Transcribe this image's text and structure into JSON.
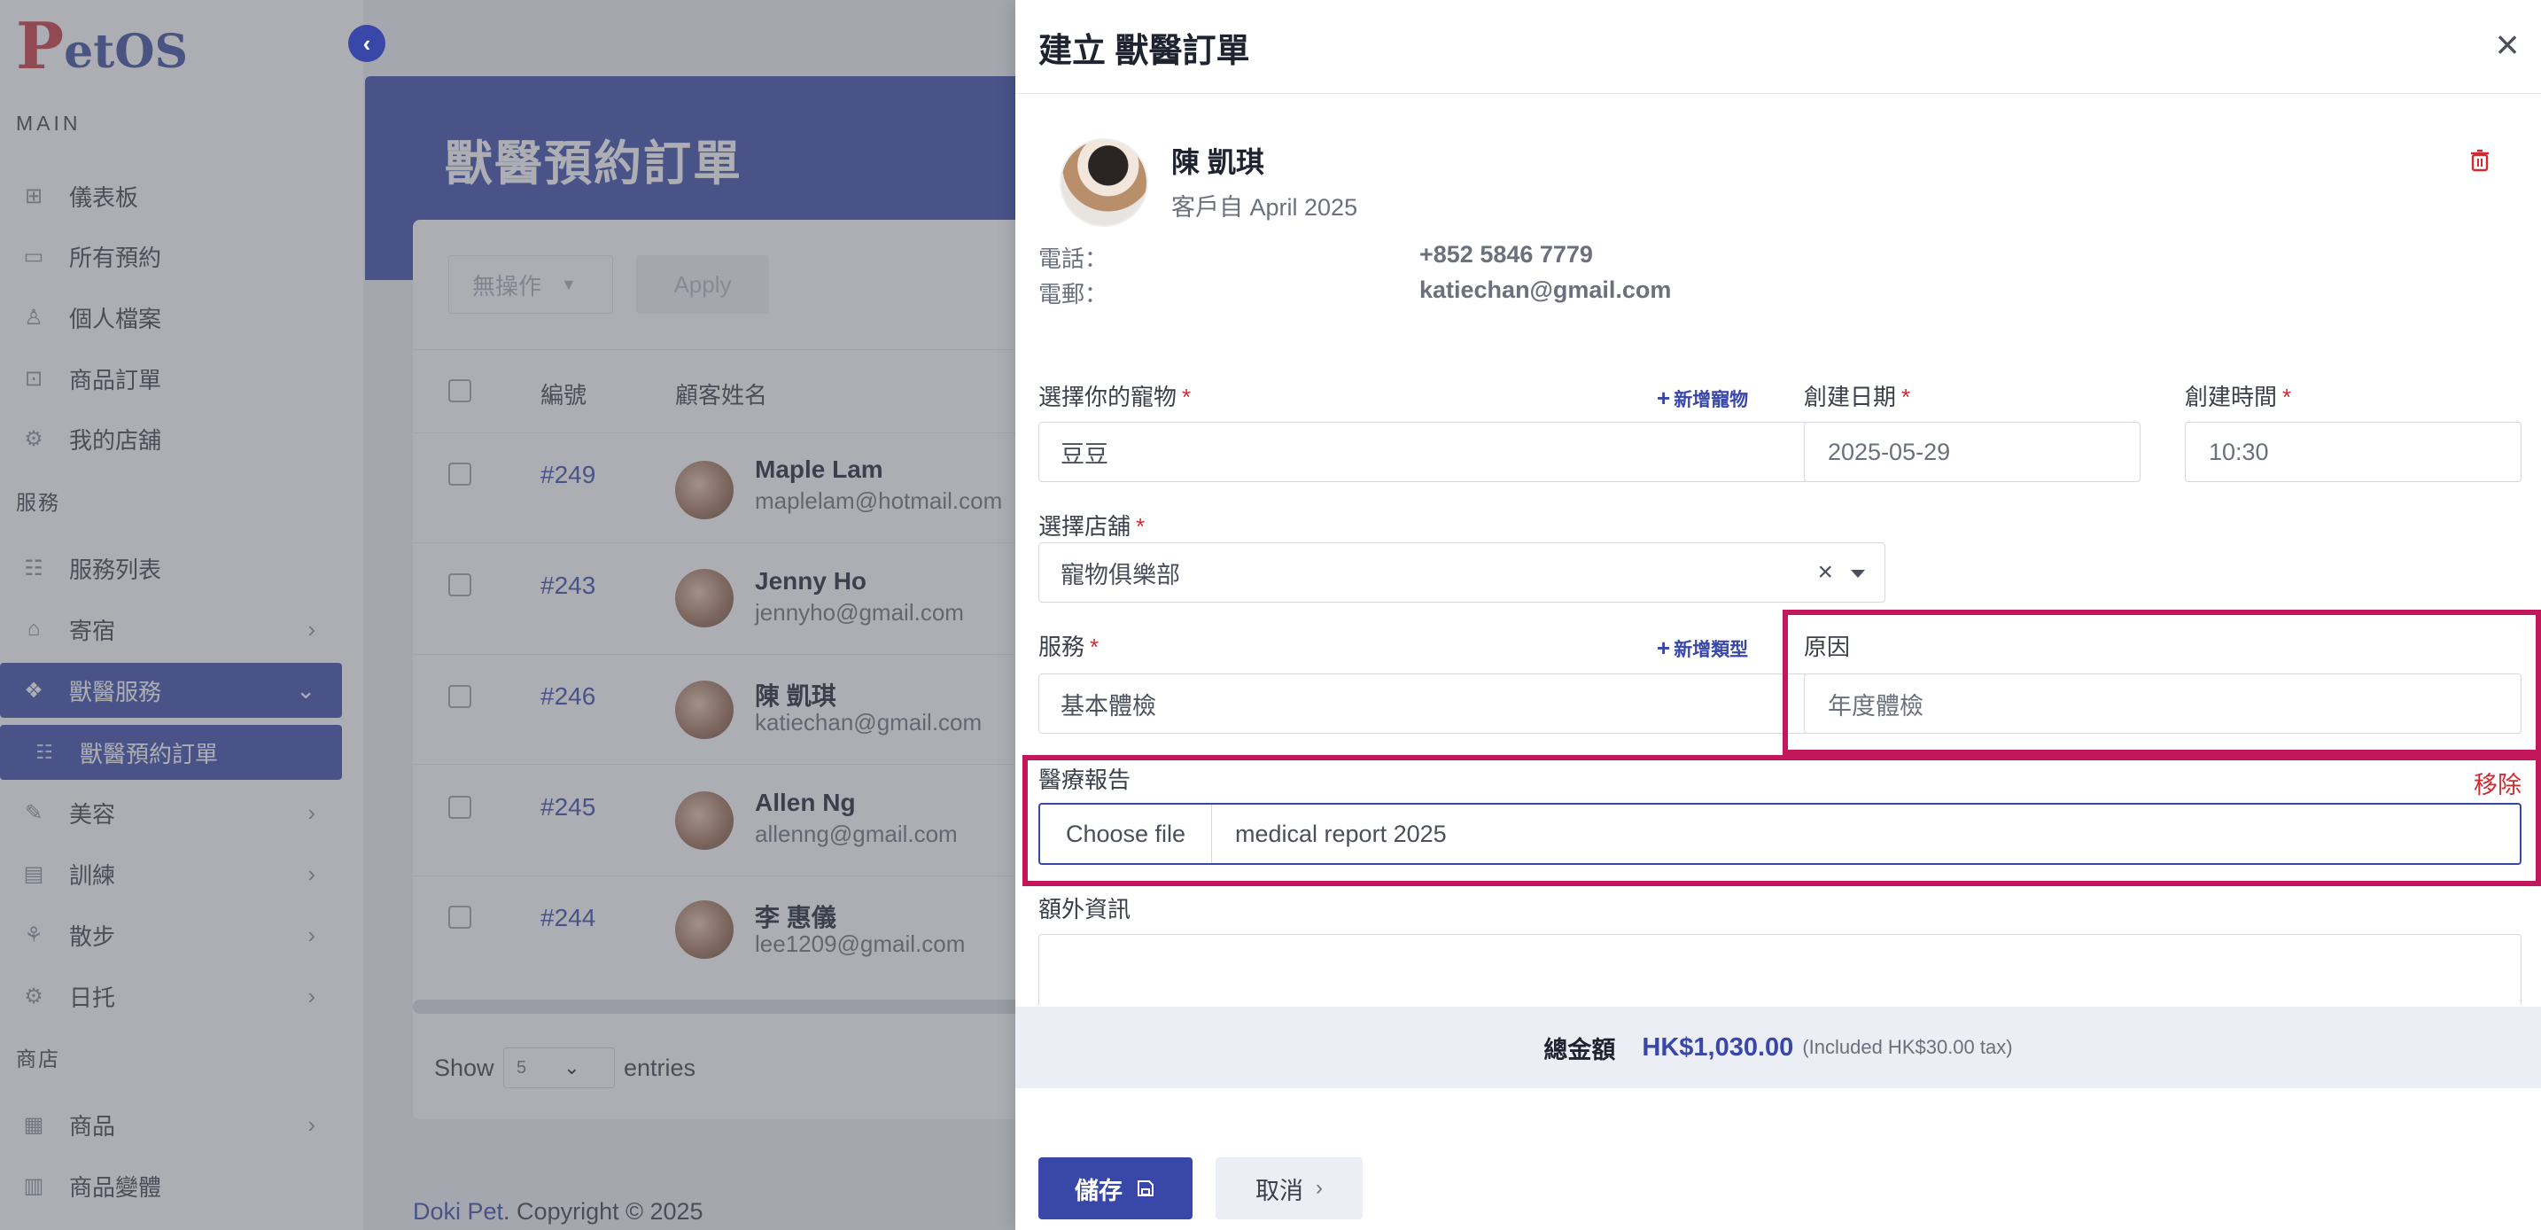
{
  "brand": {
    "logo_first": "P",
    "logo_rest": "etOS"
  },
  "sidebar": {
    "section_main": "MAIN",
    "section_service": "服務",
    "section_shop": "商店",
    "items": [
      {
        "label": "儀表板",
        "icon": "grid-icon"
      },
      {
        "label": "所有預約",
        "icon": "calendar-icon"
      },
      {
        "label": "個人檔案",
        "icon": "user-icon"
      },
      {
        "label": "商品訂單",
        "icon": "bag-icon"
      },
      {
        "label": "我的店舖",
        "icon": "store-icon"
      },
      {
        "label": "服務列表",
        "icon": "list-icon"
      },
      {
        "label": "寄宿",
        "icon": "home-icon"
      },
      {
        "label": "獸醫服務",
        "icon": "vet-icon"
      },
      {
        "label": "獸醫預約訂單",
        "icon": "list-icon"
      },
      {
        "label": "美容",
        "icon": "brush-icon"
      },
      {
        "label": "訓練",
        "icon": "training-icon"
      },
      {
        "label": "散步",
        "icon": "walk-icon"
      },
      {
        "label": "日托",
        "icon": "daycare-icon"
      },
      {
        "label": "商品",
        "icon": "product-icon"
      },
      {
        "label": "商品變體",
        "icon": "variant-icon"
      }
    ]
  },
  "page": {
    "title": "獸醫預約訂單"
  },
  "bulk": {
    "action": "無操作",
    "apply": "Apply"
  },
  "table": {
    "headers": [
      "編號",
      "顧客姓名"
    ],
    "rows": [
      {
        "id": "#249",
        "name": "Maple Lam",
        "email": "maplelam@hotmail.com"
      },
      {
        "id": "#243",
        "name": "Jenny Ho",
        "email": "jennyho@gmail.com"
      },
      {
        "id": "#246",
        "name": "陳 凱琪",
        "email": "katiechan@gmail.com"
      },
      {
        "id": "#245",
        "name": "Allen Ng",
        "email": "allenng@gmail.com"
      },
      {
        "id": "#244",
        "name": "李 惠儀",
        "email": "lee1209@gmail.com"
      }
    ],
    "show_label": "Show",
    "show_value": "5",
    "entries_label": "entries"
  },
  "footer": {
    "brand": "Doki Pet",
    "text": ". Copyright © 2025"
  },
  "drawer": {
    "title": "建立 獸醫訂單",
    "customer": {
      "name": "陳 凱琪",
      "since": "客戶自 April 2025",
      "phone_label": "電話：",
      "phone": "+852 5846 7779",
      "email_label": "電郵：",
      "email": "katiechan@gmail.com"
    },
    "form": {
      "pet_label": "選擇你的寵物",
      "pet_add": "新增寵物",
      "pet_value": "豆豆",
      "date_label": "創建日期",
      "date_value": "2025-05-29",
      "time_label": "創建時間",
      "time_value": "10:30",
      "store_label": "選擇店舖",
      "store_value": "寵物俱樂部",
      "service_label": "服務",
      "service_add": "新增類型",
      "service_value": "基本體檢",
      "reason_label": "原因",
      "reason_value": "年度體檢",
      "report_label": "醫療報告",
      "report_remove": "移除",
      "file_button": "Choose file",
      "file_name": "medical report 2025",
      "extra_label": "額外資訊",
      "required_mark": "*",
      "clear_mark": "×"
    },
    "total": {
      "label": "總金額",
      "amount": "HK$1,030.00",
      "tax": "(Included HK$30.00 tax)"
    },
    "buttons": {
      "save": "儲存",
      "cancel": "取消"
    }
  },
  "colors": {
    "primary": "#3948a8",
    "highlight": "#c2185b",
    "danger": "#d12a33"
  }
}
